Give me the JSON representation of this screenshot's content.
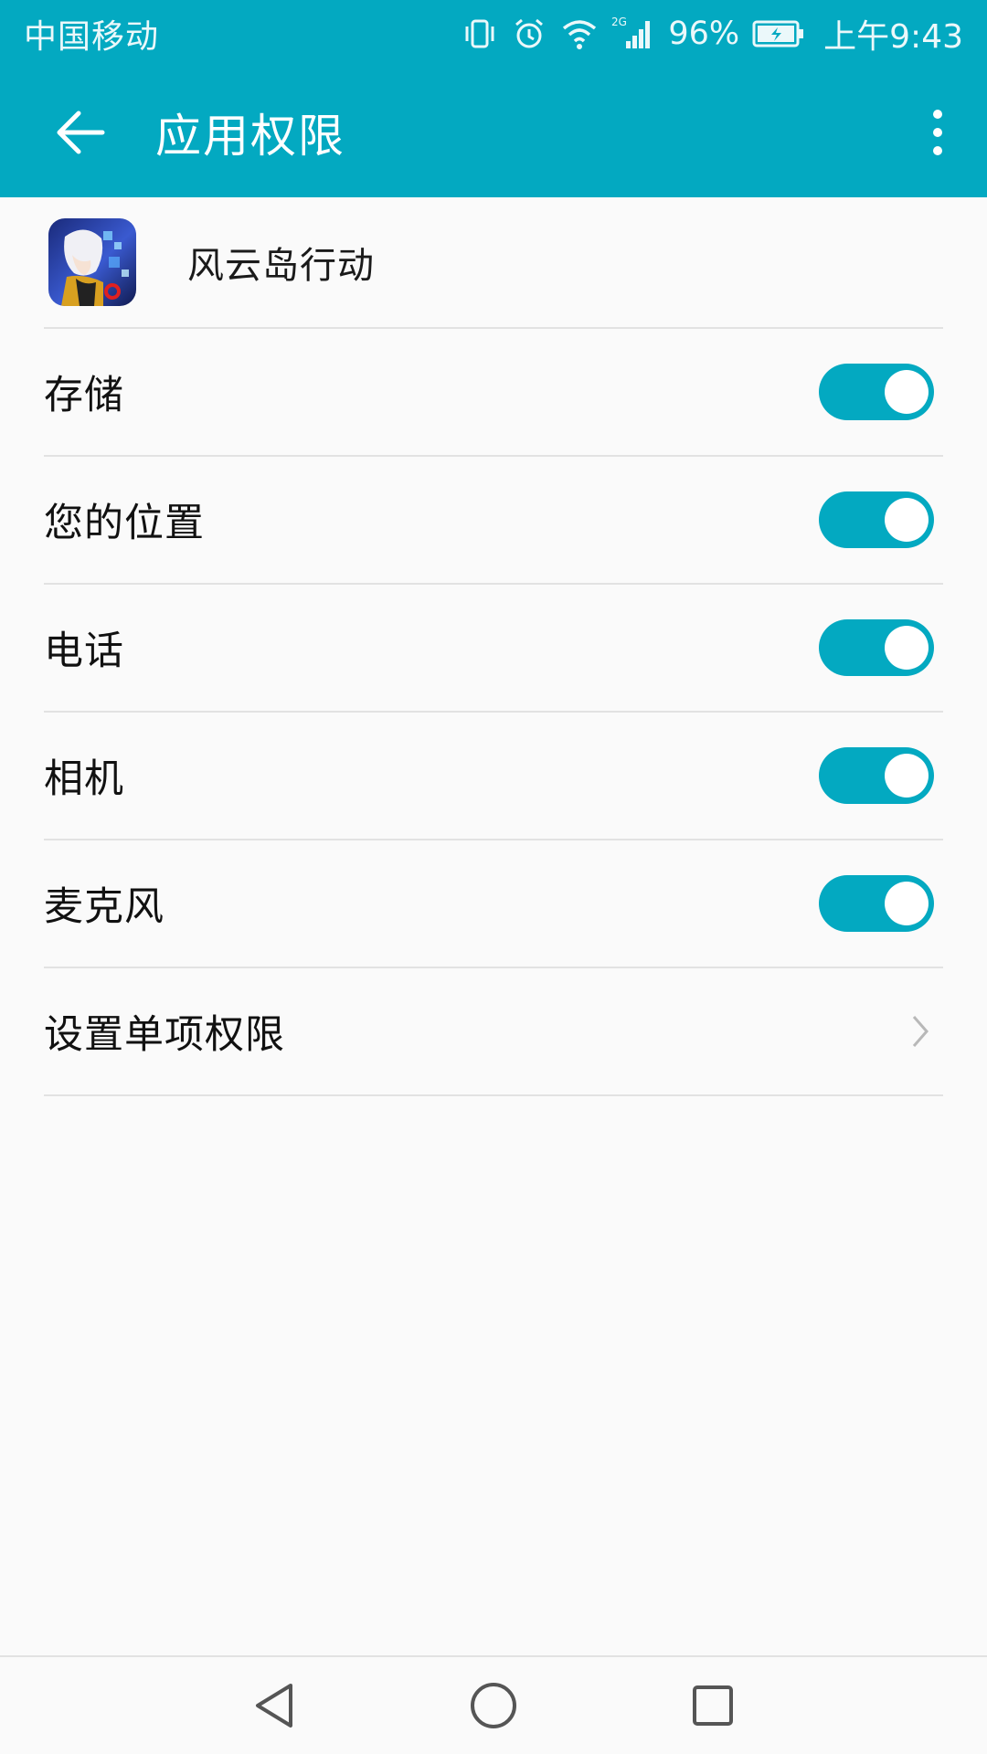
{
  "status_bar": {
    "carrier": "中国移动",
    "network": "2G",
    "battery_percent": "96%",
    "time": "上午9:43",
    "icons": [
      "vibrate-icon",
      "alarm-icon",
      "wifi-icon",
      "signal-icon",
      "battery-charging-icon"
    ]
  },
  "app_bar": {
    "title": "应用权限",
    "back_icon": "back-arrow-icon",
    "more_icon": "more-vert-icon"
  },
  "app": {
    "name": "风云岛行动",
    "icon": "app-icon"
  },
  "permissions": [
    {
      "label": "存储",
      "enabled": true
    },
    {
      "label": "您的位置",
      "enabled": true
    },
    {
      "label": "电话",
      "enabled": true
    },
    {
      "label": "相机",
      "enabled": true
    },
    {
      "label": "麦克风",
      "enabled": true
    }
  ],
  "individual_permissions": {
    "label": "设置单项权限",
    "icon": "chevron-right-icon"
  },
  "nav_bar": {
    "icons": [
      "nav-back-icon",
      "nav-home-icon",
      "nav-recents-icon"
    ]
  },
  "colors": {
    "accent": "#03a9c1",
    "background": "#fafafa",
    "divider": "#e2e2e2"
  }
}
